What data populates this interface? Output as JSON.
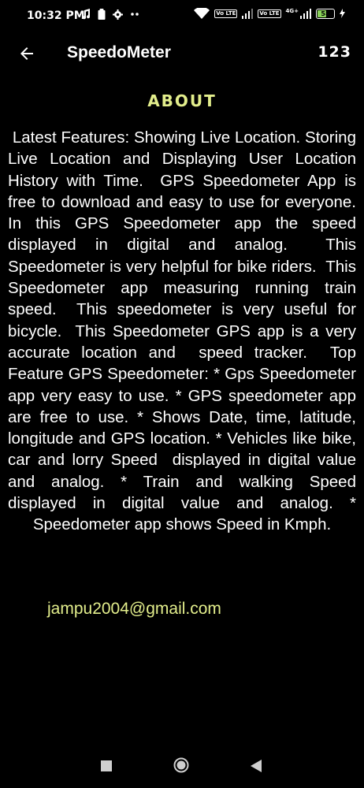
{
  "status_bar": {
    "time": "10:32 PM",
    "left_icons": [
      "music-note-icon",
      "clipboard-icon",
      "settings-gear-icon",
      "more-dots-icon"
    ],
    "network_label_1": "Vo LTE",
    "network_label_2": "Vo LTE",
    "network_type": "4G+",
    "battery_level": "58",
    "battery_fraction": 0.58
  },
  "app_bar": {
    "title": "SpeedoMeter",
    "numbers_label": "123"
  },
  "about": {
    "heading": "ABOUT",
    "body": " Latest Features: Showing Live Location. Storing Live Location and Displaying User Location History with Time.  GPS Speedometer App is free to download and easy to use for everyone.  In this GPS Speedometer app the speed displayed in digital and analog.  This Speedometer is very helpful for bike riders.  This Speedometer app measuring running train speed.  This speedometer is very useful for bicycle.  This Speedometer GPS app is a very accurate location and  speed tracker.  Top Feature GPS Speedometer: * Gps Speedometer app very easy to use. * GPS speedometer app are free to use. * Shows Date, time, latitude, longitude and GPS location. * Vehicles like bike, car and lorry Speed  displayed in digital value and analog. * Train and walking Speed displayed in digital value and analog. * Speedometer app shows Speed in Kmph.",
    "email": "jampu2004@gmail.com"
  },
  "colors": {
    "background": "#000000",
    "accent": "#e3ee8c",
    "text": "#ffffff",
    "battery": "#8bd35a"
  }
}
